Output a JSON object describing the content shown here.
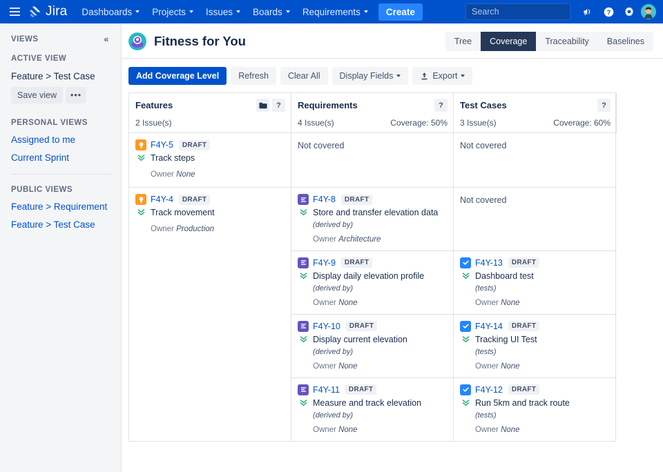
{
  "topnav": {
    "menu_icon": "hamburger-icon",
    "logo_text": "Jira",
    "items": [
      {
        "label": "Dashboards",
        "has_caret": true
      },
      {
        "label": "Projects",
        "has_caret": true
      },
      {
        "label": "Issues",
        "has_caret": true
      },
      {
        "label": "Boards",
        "has_caret": true
      },
      {
        "label": "Requirements",
        "has_caret": true
      }
    ],
    "create_label": "Create",
    "search": {
      "placeholder": "Search",
      "value": "",
      "icon": "search-icon"
    },
    "right_icons": [
      "megaphone-icon",
      "help-circle-icon",
      "gear-icon",
      "avatar"
    ]
  },
  "sidebar": {
    "heading": "VIEWS",
    "collapse_icon": "chevron-double-left-icon",
    "active_view_label": "ACTIVE VIEW",
    "active_view_name": "Feature > Test Case",
    "save_view_label": "Save view",
    "more_label": "•••",
    "personal_views_label": "PERSONAL VIEWS",
    "personal_views": [
      "Assigned to me",
      "Current Sprint"
    ],
    "public_views_label": "PUBLIC VIEWS",
    "public_views": [
      "Feature > Requirement",
      "Feature > Test Case"
    ]
  },
  "header": {
    "project_avatar": "project-avatar-icon",
    "title": "Fitness for You",
    "tabs": [
      {
        "label": "Tree",
        "active": false
      },
      {
        "label": "Coverage",
        "active": true
      },
      {
        "label": "Traceability",
        "active": false
      },
      {
        "label": "Baselines",
        "active": false
      }
    ]
  },
  "toolbar": {
    "add_coverage_level": "Add Coverage Level",
    "refresh": "Refresh",
    "clear_all": "Clear All",
    "display_fields": "Display Fields",
    "export": "Export",
    "export_icon": "upload-icon"
  },
  "matrix": {
    "columns": [
      {
        "title": "Features",
        "issue_count": "2 Issue(s)",
        "coverage": "",
        "icons": [
          "folder-icon",
          "help-icon"
        ]
      },
      {
        "title": "Requirements",
        "issue_count": "4 Issue(s)",
        "coverage": "Coverage: 50%",
        "icons": [
          "help-icon"
        ]
      },
      {
        "title": "Test Cases",
        "issue_count": "3 Issue(s)",
        "coverage": "Coverage: 60%",
        "icons": [
          "help-icon"
        ]
      }
    ],
    "owner_label": "Owner",
    "not_covered_label": "Not covered",
    "rows": [
      {
        "feature": {
          "key": "F4Y-5",
          "status": "DRAFT",
          "summary": "Track steps",
          "owner": "None",
          "type_icon": "feature-bulb-icon",
          "priority_icon": "priority-low-icon"
        },
        "subrows": [
          {
            "requirement": null,
            "testcase": null
          }
        ]
      },
      {
        "feature": {
          "key": "F4Y-4",
          "status": "DRAFT",
          "summary": "Track movement",
          "owner": "Production",
          "type_icon": "feature-bulb-icon",
          "priority_icon": "priority-low-icon"
        },
        "subrows": [
          {
            "requirement": {
              "key": "F4Y-8",
              "status": "DRAFT",
              "summary": "Store and transfer elevation data",
              "relation": "(derived by)",
              "owner": "Architecture",
              "type_icon": "requirement-doc-icon",
              "priority_icon": "priority-low-icon"
            },
            "testcase": null
          },
          {
            "requirement": {
              "key": "F4Y-9",
              "status": "DRAFT",
              "summary": "Display daily elevation profile",
              "relation": "(derived by)",
              "owner": "None",
              "type_icon": "requirement-doc-icon",
              "priority_icon": "priority-low-icon"
            },
            "testcase": {
              "key": "F4Y-13",
              "status": "DRAFT",
              "summary": "Dashboard test",
              "relation": "(tests)",
              "owner": "None",
              "type_icon": "testcase-check-icon",
              "priority_icon": "priority-low-icon"
            }
          },
          {
            "requirement": {
              "key": "F4Y-10",
              "status": "DRAFT",
              "summary": "Display current elevation",
              "relation": "(derived by)",
              "owner": "None",
              "type_icon": "requirement-doc-icon",
              "priority_icon": "priority-low-icon"
            },
            "testcase": {
              "key": "F4Y-14",
              "status": "DRAFT",
              "summary": "Tracking UI Test",
              "relation": "(tests)",
              "owner": "None",
              "type_icon": "testcase-check-icon",
              "priority_icon": "priority-low-icon"
            }
          },
          {
            "requirement": {
              "key": "F4Y-11",
              "status": "DRAFT",
              "summary": "Measure and track elevation",
              "relation": "(derived by)",
              "owner": "None",
              "type_icon": "requirement-doc-icon",
              "priority_icon": "priority-low-icon"
            },
            "testcase": {
              "key": "F4Y-12",
              "status": "DRAFT",
              "summary": "Run 5km and track route",
              "relation": "(tests)",
              "owner": "None",
              "type_icon": "testcase-check-icon",
              "priority_icon": "priority-low-icon"
            }
          }
        ]
      }
    ]
  },
  "colors": {
    "nav_blue": "#0052cc",
    "create_blue": "#2684ff",
    "tab_active": "#253858",
    "feature_orange": "#ff991f",
    "requirement_purple": "#6554c0",
    "testcase_blue": "#2684ff",
    "priority_green": "#36b37e",
    "link_blue": "#0052cc"
  }
}
